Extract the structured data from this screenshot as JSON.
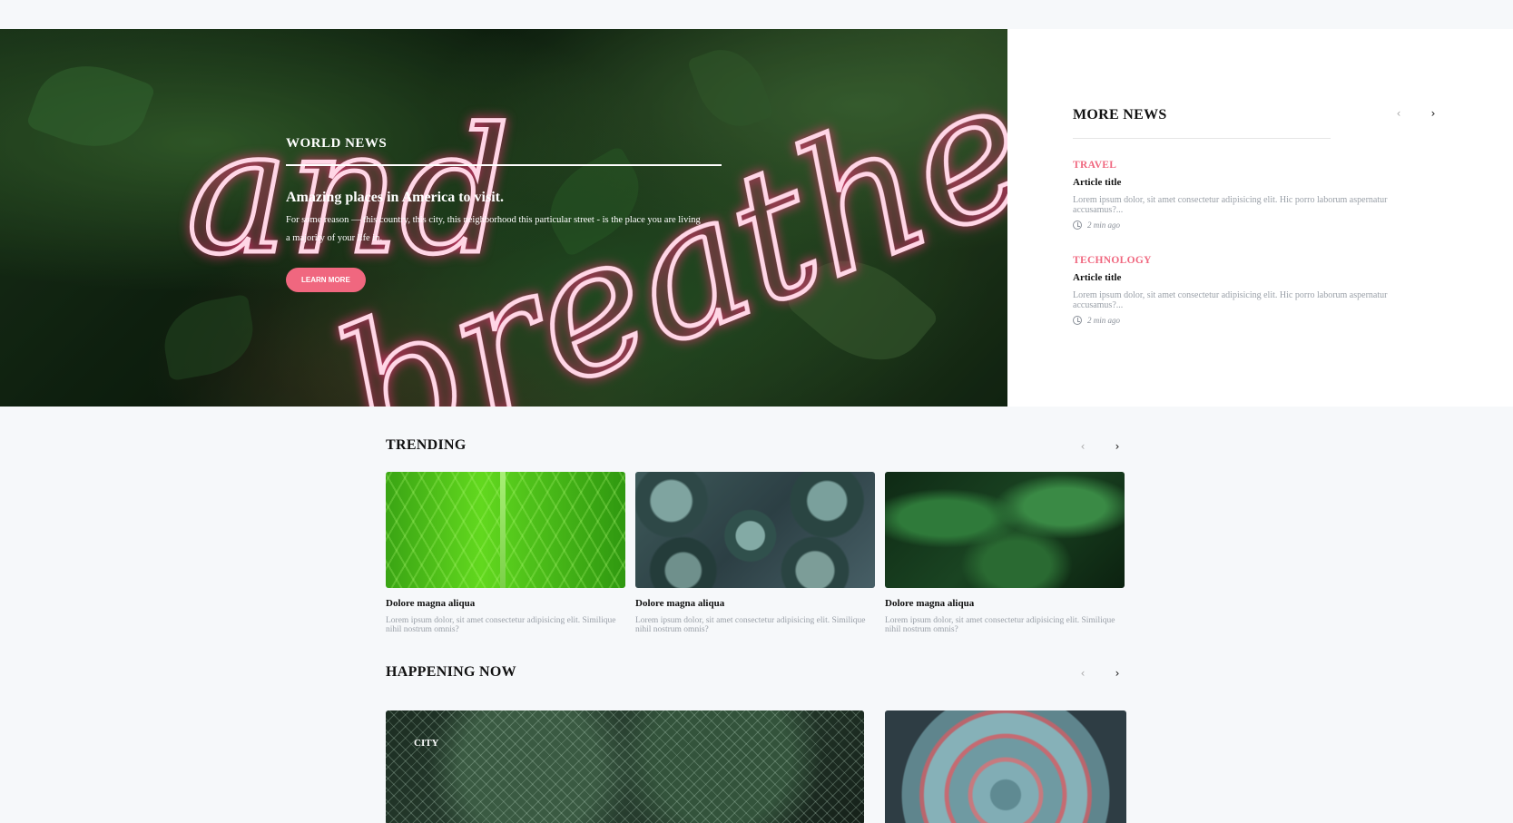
{
  "hero": {
    "category": "WORLD NEWS",
    "title": "Amazing places in America to visit.",
    "description": "For some reason — this country, this city, this neighborhood this particular street - is the place you are living a majority of your life in.",
    "button": "LEARN MORE",
    "neon_text_line1": "and",
    "neon_text_line2": "breathe"
  },
  "more_news": {
    "title": "MORE NEWS",
    "prev_icon": "‹",
    "next_icon": "›",
    "items": [
      {
        "category": "TRAVEL",
        "title": "Article title",
        "description": "Lorem ipsum dolor, sit amet consectetur adipisicing elit. Hic porro laborum aspernatur accusamus?...",
        "time": "2 min ago"
      },
      {
        "category": "TECHNOLOGY",
        "title": "Article title",
        "description": "Lorem ipsum dolor, sit amet consectetur adipisicing elit. Hic porro laborum aspernatur accusamus?...",
        "time": "2 min ago"
      }
    ]
  },
  "trending": {
    "title": "TRENDING",
    "prev_icon": "‹",
    "next_icon": "›",
    "cards": [
      {
        "title": "Dolore magna aliqua",
        "description": "Lorem ipsum dolor, sit amet consectetur adipisicing elit. Similique nihil nostrum omnis?"
      },
      {
        "title": "Dolore magna aliqua",
        "description": "Lorem ipsum dolor, sit amet consectetur adipisicing elit. Similique nihil nostrum omnis?"
      },
      {
        "title": "Dolore magna aliqua",
        "description": "Lorem ipsum dolor, sit amet consectetur adipisicing elit. Similique nihil nostrum omnis?"
      }
    ]
  },
  "happening_now": {
    "title": "HAPPENING NOW",
    "prev_icon": "‹",
    "next_icon": "›",
    "cards": [
      {
        "category": "CITY"
      }
    ]
  },
  "colors": {
    "accent": "#f0677f",
    "page_bg": "#f6f8fa",
    "muted_text": "#9aa0a8"
  }
}
